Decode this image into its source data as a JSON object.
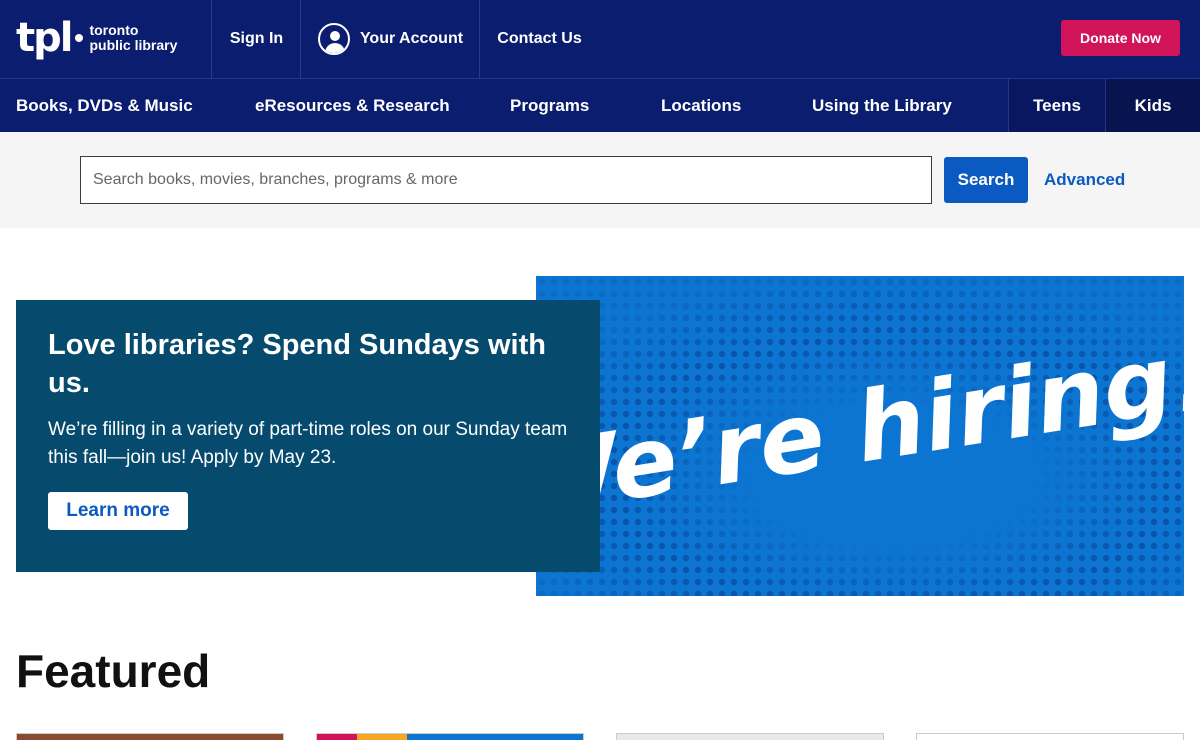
{
  "header": {
    "logo": {
      "mark": "tpl",
      "line1": "toronto",
      "line2": "public library"
    },
    "sign_in": "Sign In",
    "your_account": "Your Account",
    "contact_us": "Contact Us",
    "donate_now": "Donate Now"
  },
  "nav": {
    "items": [
      {
        "label": "Books, DVDs & Music"
      },
      {
        "label": "eResources & Research"
      },
      {
        "label": "Programs"
      },
      {
        "label": "Locations"
      },
      {
        "label": "Using the Library"
      },
      {
        "label": "Teens"
      },
      {
        "label": "Kids"
      }
    ]
  },
  "search": {
    "placeholder": "Search books, movies, branches, programs & more",
    "button_label": "Search",
    "advanced_label": "Advanced"
  },
  "hero": {
    "title": "Love libraries? Spend Sundays with us.",
    "body": "We’re filling in a variety of part-time roles on our Sunday team this fall—join us! Apply by May 23.",
    "button_label": "Learn more",
    "image_text": "We’re hiring!"
  },
  "featured": {
    "heading": "Featured"
  },
  "colors": {
    "header_bg": "#0b1d6f",
    "donate": "#d1145a",
    "link_blue": "#0a5ac2",
    "hero_card": "#064b6e",
    "hero_image": "#0c75d1"
  }
}
